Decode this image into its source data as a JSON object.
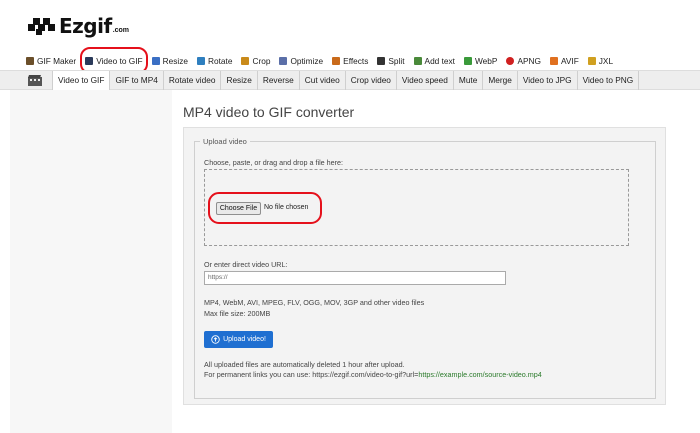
{
  "site": {
    "name": "Ezgif",
    "domain": ".com"
  },
  "mainnav": [
    {
      "label": "GIF Maker",
      "icon": "gif-maker-icon",
      "color": "#6b4f2a"
    },
    {
      "label": "Video to GIF",
      "icon": "film-icon",
      "color": "#2b3a5a"
    },
    {
      "label": "Resize",
      "icon": "resize-icon",
      "color": "#3a6fc4"
    },
    {
      "label": "Rotate",
      "icon": "rotate-icon",
      "color": "#2f7fbf"
    },
    {
      "label": "Crop",
      "icon": "crop-icon",
      "color": "#c98a1a"
    },
    {
      "label": "Optimize",
      "icon": "optimize-icon",
      "color": "#5b6fa8"
    },
    {
      "label": "Effects",
      "icon": "effects-icon",
      "color": "#c96a1a"
    },
    {
      "label": "Split",
      "icon": "split-icon",
      "color": "#333333"
    },
    {
      "label": "Add text",
      "icon": "add-text-icon",
      "color": "#4a8a3a"
    },
    {
      "label": "WebP",
      "icon": "webp-icon",
      "color": "#3a9a3a"
    },
    {
      "label": "APNG",
      "icon": "apng-icon",
      "color": "#d02020"
    },
    {
      "label": "AVIF",
      "icon": "avif-icon",
      "color": "#e07020"
    },
    {
      "label": "JXL",
      "icon": "jxl-icon",
      "color": "#d0a020"
    }
  ],
  "subnav": {
    "tabs": [
      "Video to GIF",
      "GIF to MP4",
      "Rotate video",
      "Resize",
      "Reverse",
      "Cut video",
      "Crop video",
      "Video speed",
      "Mute",
      "Merge",
      "Video to JPG",
      "Video to PNG"
    ],
    "active": "Video to GIF"
  },
  "page": {
    "title": "MP4 video to GIF converter"
  },
  "upload": {
    "legend": "Upload video",
    "instruction": "Choose, paste, or drag and drop a file here:",
    "choose_label": "Choose File",
    "file_status": "No file chosen",
    "url_label": "Or enter direct video URL:",
    "url_placeholder": "https://",
    "formats": "MP4, WebM, AVI, MPEG, FLV, OGG, MOV, 3GP and other video files",
    "max_size": "Max file size: 200MB",
    "upload_label": "Upload video!",
    "note1": "All uploaded files are automatically deleted 1 hour after upload.",
    "note2_prefix": "For permanent links you can use: https://ezgif.com/video-to-gif?url=",
    "note2_link": "https://example.com/source-video.mp4"
  },
  "colors": {
    "accent": "#1f6fd1",
    "highlight": "#e5101b",
    "link": "#2a7a2a"
  }
}
